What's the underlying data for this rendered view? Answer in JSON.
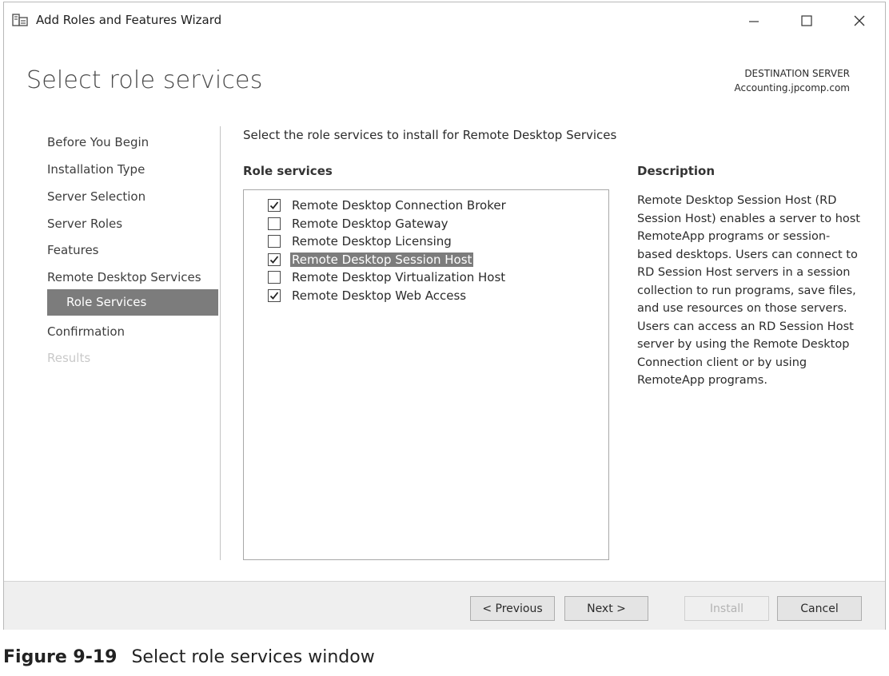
{
  "window": {
    "title": "Add Roles and Features Wizard"
  },
  "page": {
    "title": "Select role services"
  },
  "destination": {
    "label": "DESTINATION SERVER",
    "server": "Accounting.jpcomp.com"
  },
  "nav": {
    "items": [
      {
        "label": "Before You Begin",
        "state": "normal"
      },
      {
        "label": "Installation Type",
        "state": "normal"
      },
      {
        "label": "Server Selection",
        "state": "normal"
      },
      {
        "label": "Server Roles",
        "state": "normal"
      },
      {
        "label": "Features",
        "state": "normal"
      },
      {
        "label": "Remote Desktop Services",
        "state": "normal"
      },
      {
        "label": "Role Services",
        "state": "active"
      },
      {
        "label": "Confirmation",
        "state": "normal"
      },
      {
        "label": "Results",
        "state": "disabled"
      }
    ]
  },
  "content": {
    "instruction": "Select the role services to install for Remote Desktop Services",
    "role_services_header": "Role services",
    "description_header": "Description",
    "roles": [
      {
        "label": "Remote Desktop Connection Broker",
        "checked": true,
        "selected": false
      },
      {
        "label": "Remote Desktop Gateway",
        "checked": false,
        "selected": false
      },
      {
        "label": "Remote Desktop Licensing",
        "checked": false,
        "selected": false
      },
      {
        "label": "Remote Desktop Session Host",
        "checked": true,
        "selected": true
      },
      {
        "label": "Remote Desktop Virtualization Host",
        "checked": false,
        "selected": false
      },
      {
        "label": "Remote Desktop Web Access",
        "checked": true,
        "selected": false
      }
    ],
    "description": "Remote Desktop Session Host (RD Session Host) enables a server to host RemoteApp programs or session-based desktops. Users can connect to RD Session Host servers in a session collection to run programs, save files, and use resources on those servers. Users can access an RD Session Host server by using the Remote Desktop Connection client or by using RemoteApp programs."
  },
  "buttons": {
    "previous": "< Previous",
    "next": "Next >",
    "install": "Install",
    "cancel": "Cancel"
  },
  "caption": {
    "number": "Figure 9-19",
    "text": "Select role services window"
  }
}
